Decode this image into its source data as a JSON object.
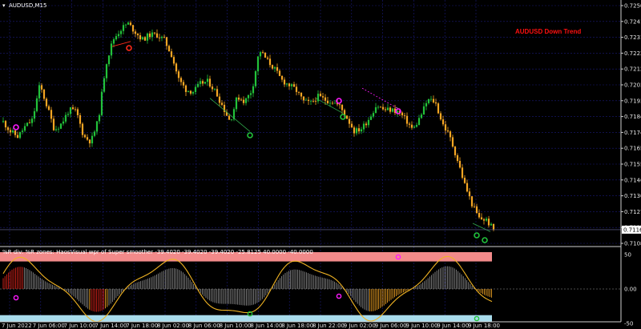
{
  "window": {
    "symbol_title": "AUDUSD,M15",
    "menu_glyph": "▾"
  },
  "annotation": {
    "trend_text": "AUDUSD Down Trend",
    "trend_color": "#ff1010"
  },
  "price_axis": {
    "ticks": [
      "0.72505",
      "0.72410",
      "0.72315",
      "0.72220",
      "0.72125",
      "0.72030",
      "0.71935",
      "0.71840",
      "0.71745",
      "0.71650",
      "0.71555",
      "0.71460",
      "0.71365",
      "0.71270",
      "0.71175",
      "0.71080"
    ],
    "current_price": "0.71162"
  },
  "indicator": {
    "title": "%R div: %R zones:  HaosVisual wpr of Super smoother -39.4020 -39.4020 -39.4020 -25.8125 40.0000 -40.0000",
    "ticks": [
      "50",
      "0.00",
      "-50"
    ],
    "upper_zone_color": "#f28a8a",
    "lower_zone_color": "#a8dcec"
  },
  "time_axis": {
    "labels": [
      "7 Jun 2022",
      "7 Jun 06:00",
      "7 Jun 10:00",
      "7 Jun 14:00",
      "7 Jun 18:00",
      "8 Jun 02:00",
      "8 Jun 06:00",
      "8 Jun 10:00",
      "8 Jun 14:00",
      "8 Jun 18:00",
      "8 Jun 22:00",
      "9 Jun 02:00",
      "9 Jun 06:00",
      "9 Jun 10:00",
      "9 Jun 14:00",
      "9 Jun 18:00"
    ]
  },
  "colors": {
    "bull": "#22c23a",
    "bear": "#f5a623",
    "grid": "#1a1a7a",
    "signal_top": "#ff1aff",
    "signal_bottom": "#22c23a",
    "signal_red": "#ff2a1a"
  },
  "chart_data": {
    "type": "candlestick",
    "symbol": "AUDUSD",
    "timeframe": "M15",
    "x_range": [
      "7 Jun 2022",
      "9 Jun 18:00"
    ],
    "y_range": [
      0.7108,
      0.72505
    ],
    "close_path": [
      0.71808,
      0.7175,
      0.7172,
      0.7178,
      0.7182,
      0.7203,
      0.719,
      0.7176,
      0.718,
      0.7188,
      0.7187,
      0.7172,
      0.7169,
      0.7182,
      0.7215,
      0.723,
      0.7236,
      0.724,
      0.7235,
      0.723,
      0.7233,
      0.7233,
      0.723,
      0.7221,
      0.7206,
      0.72,
      0.7199,
      0.7204,
      0.7205,
      0.7199,
      0.719,
      0.7181,
      0.7196,
      0.7193,
      0.72,
      0.7224,
      0.7218,
      0.7213,
      0.7206,
      0.7203,
      0.72,
      0.7193,
      0.7192,
      0.7196,
      0.7194,
      0.7193,
      0.719,
      0.7183,
      0.7175,
      0.7177,
      0.7183,
      0.7191,
      0.7188,
      0.7188,
      0.7187,
      0.7182,
      0.7176,
      0.7184,
      0.7194,
      0.7193,
      0.718,
      0.7172,
      0.7159,
      0.7144,
      0.7132,
      0.7123,
      0.7122,
      0.71162
    ],
    "indicator_range": [
      -50,
      50
    ],
    "indicator_levels": [
      40,
      -40
    ]
  }
}
